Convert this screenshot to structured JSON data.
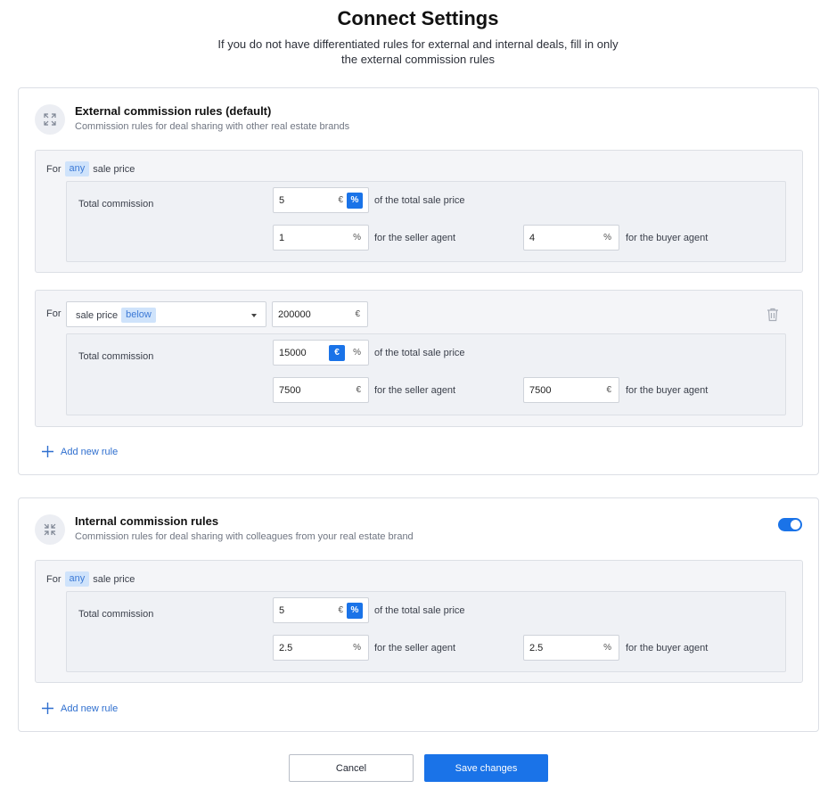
{
  "page": {
    "title": "Connect Settings",
    "subtitle": "If you do not have differentiated rules for external and internal deals, fill in only the external commission rules"
  },
  "external": {
    "title": "External commission rules (default)",
    "description": "Commission rules for deal sharing with other real estate brands",
    "rule1": {
      "for_label": "For",
      "tag": "any",
      "suffix": "sale price",
      "total_label": "Total commission",
      "total_value": "5",
      "unit_euro": "€",
      "unit_pct": "%",
      "selected_unit": "%",
      "of_total": "of the total sale price",
      "seller_value": "1",
      "seller_unit": "%",
      "seller_label": "for the seller agent",
      "buyer_value": "4",
      "buyer_unit": "%",
      "buyer_label": "for the buyer agent"
    },
    "rule2": {
      "for_label": "For",
      "select_text": "sale price",
      "select_tag": "below",
      "threshold_value": "200000",
      "threshold_unit": "€",
      "total_label": "Total commission",
      "total_value": "15000",
      "unit_euro": "€",
      "unit_pct": "%",
      "selected_unit": "€",
      "of_total": "of the total sale price",
      "seller_value": "7500",
      "seller_unit": "€",
      "seller_label": "for the seller agent",
      "buyer_value": "7500",
      "buyer_unit": "€",
      "buyer_label": "for the buyer agent"
    },
    "add_rule": "Add new rule"
  },
  "internal": {
    "title": "Internal commission rules",
    "description": "Commission rules for deal sharing with colleagues from your real estate brand",
    "enabled": true,
    "rule1": {
      "for_label": "For",
      "tag": "any",
      "suffix": "sale price",
      "total_label": "Total commission",
      "total_value": "5",
      "unit_euro": "€",
      "unit_pct": "%",
      "selected_unit": "%",
      "of_total": "of the total sale price",
      "seller_value": "2.5",
      "seller_unit": "%",
      "seller_label": "for the seller agent",
      "buyer_value": "2.5",
      "buyer_unit": "%",
      "buyer_label": "for the buyer agent"
    },
    "add_rule": "Add new rule"
  },
  "actions": {
    "cancel": "Cancel",
    "save": "Save changes"
  },
  "colors": {
    "accent": "#1a73e8",
    "tag_bg": "#cfe3fb",
    "link": "#2f6fcf"
  }
}
